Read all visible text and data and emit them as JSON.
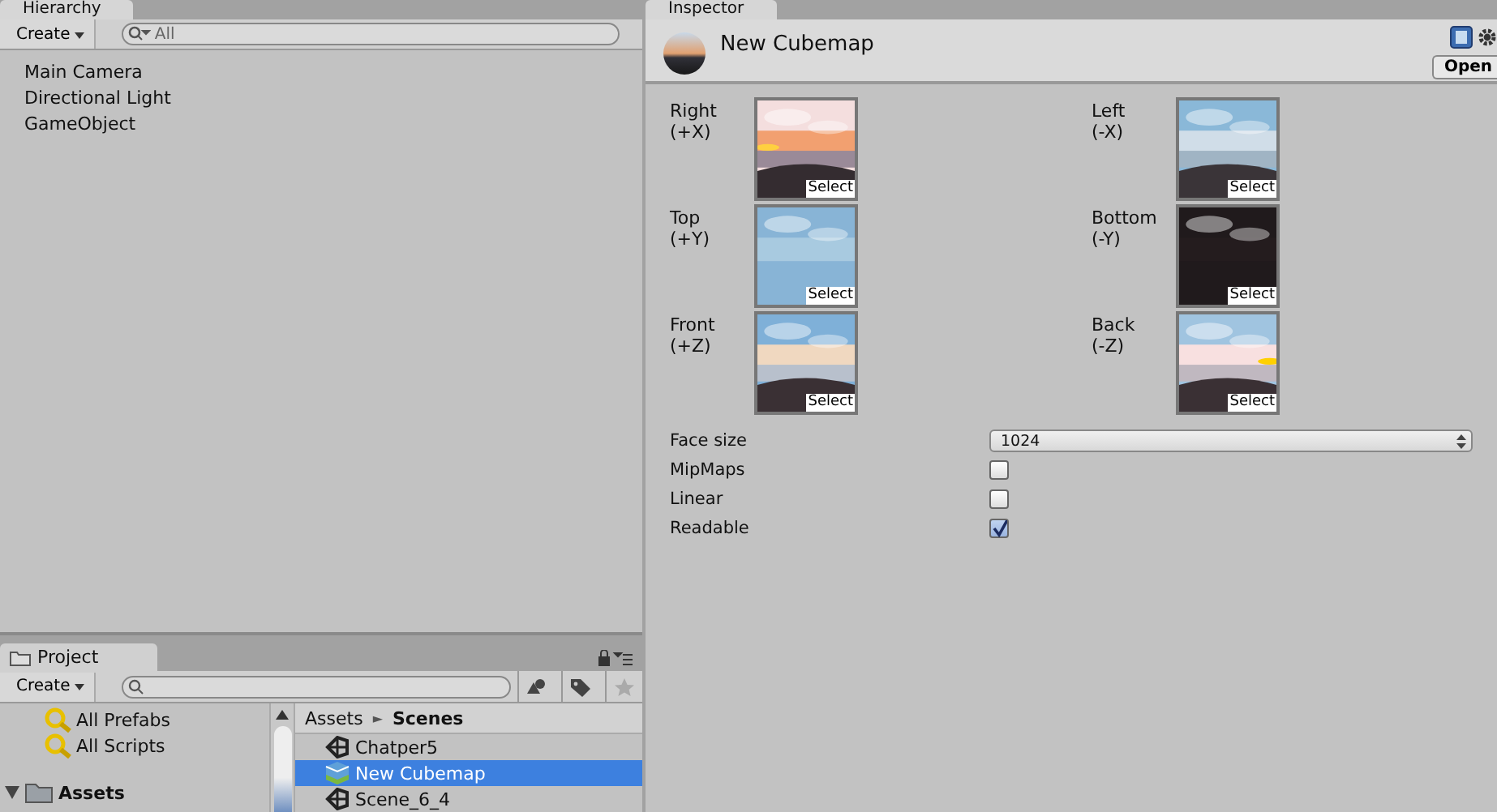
{
  "hierarchy": {
    "tab": "Hierarchy",
    "create": "Create",
    "search": {
      "placeholder": "All"
    },
    "items": [
      {
        "label": "Main Camera",
        "selected": false
      },
      {
        "label": "Directional Light",
        "selected": false
      },
      {
        "label": "GameObject",
        "selected": false
      }
    ]
  },
  "project": {
    "tab": "Project",
    "create": "Create",
    "favorites": [
      {
        "label": "All Prefabs"
      },
      {
        "label": "All Scripts"
      }
    ],
    "root": {
      "label": "Assets",
      "expanded": true
    },
    "breadcrumb": [
      "Assets",
      "Scenes"
    ],
    "separator": "►",
    "files": [
      {
        "label": "Chatper5",
        "kind": "scene",
        "selected": false
      },
      {
        "label": "New Cubemap",
        "kind": "cubemap",
        "selected": true
      },
      {
        "label": "Scene_6_4",
        "kind": "scene",
        "selected": false
      }
    ]
  },
  "inspector": {
    "tab": "Inspector",
    "title": "New Cubemap",
    "open_button": "Open",
    "faces": [
      {
        "label": "Right",
        "axis": "(+X)",
        "button": "Select"
      },
      {
        "label": "Left",
        "axis": "(-X)",
        "button": "Select"
      },
      {
        "label": "Top",
        "axis": "(+Y)",
        "button": "Select"
      },
      {
        "label": "Bottom",
        "axis": "(-Y)",
        "button": "Select"
      },
      {
        "label": "Front",
        "axis": "(+Z)",
        "button": "Select"
      },
      {
        "label": "Back",
        "axis": "(-Z)",
        "button": "Select"
      }
    ],
    "face_size": {
      "label": "Face size",
      "value": "1024"
    },
    "options": [
      {
        "label": "MipMaps",
        "checked": false
      },
      {
        "label": "Linear",
        "checked": false
      },
      {
        "label": "Readable",
        "checked": true
      }
    ]
  }
}
